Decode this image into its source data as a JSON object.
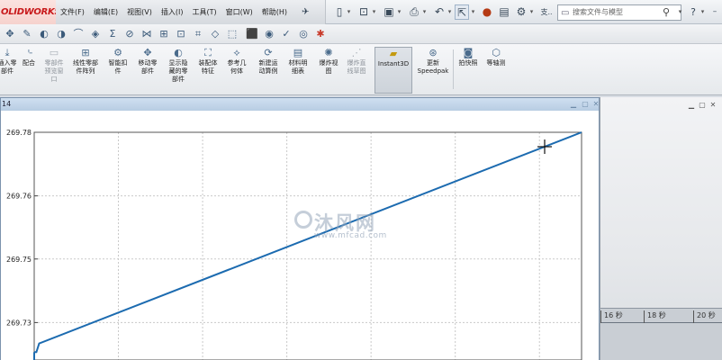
{
  "app": {
    "logo": "OLIDWORKS"
  },
  "menu": [
    "文件(F)",
    "编辑(E)",
    "视图(V)",
    "插入(I)",
    "工具(T)",
    "窗口(W)",
    "帮助(H)"
  ],
  "quickbar": {
    "more_label": "支..",
    "search_placeholder": "搜索文件与模型",
    "help_label": "?"
  },
  "commands": [
    {
      "label": "插入零\n部件",
      "icon": "insert-component-icon",
      "enabled": true
    },
    {
      "label": "配合",
      "icon": "mate-icon",
      "enabled": true
    },
    {
      "label": "零部件\n预览窗\n口",
      "icon": "component-preview-icon",
      "enabled": false
    },
    {
      "label": "线性零部\n件阵列",
      "icon": "linear-pattern-icon",
      "enabled": true
    },
    {
      "label": "智能扣\n件",
      "icon": "smart-fastener-icon",
      "enabled": true
    },
    {
      "label": "移动零\n部件",
      "icon": "move-component-icon",
      "enabled": true
    },
    {
      "label": "显示隐\n藏的零\n部件",
      "icon": "show-hidden-icon",
      "enabled": true
    },
    {
      "label": "装配体\n特征",
      "icon": "assembly-feature-icon",
      "enabled": true
    },
    {
      "label": "参考几\n何体",
      "icon": "reference-geometry-icon",
      "enabled": true
    },
    {
      "label": "新建运\n动算例",
      "icon": "motion-study-icon",
      "enabled": true
    },
    {
      "label": "材料明\n细表",
      "icon": "bom-icon",
      "enabled": true
    },
    {
      "label": "爆炸视\n图",
      "icon": "exploded-view-icon",
      "enabled": true
    },
    {
      "label": "爆炸直\n线草图",
      "icon": "explode-line-icon",
      "enabled": false
    },
    {
      "label": "Instant3D",
      "icon": "instant3d-icon",
      "enabled": true,
      "active": true
    },
    {
      "label": "更新\nSpeedpak",
      "icon": "speedpak-icon",
      "enabled": true
    },
    {
      "label": "拍快照",
      "icon": "snapshot-icon",
      "enabled": true
    },
    {
      "label": "等轴测",
      "icon": "isometric-icon",
      "enabled": true
    }
  ],
  "plot": {
    "caption": "14"
  },
  "chart_data": {
    "type": "line",
    "x": [
      0,
      0.004,
      0.009,
      1.0
    ],
    "y": [
      269.7295,
      269.7295,
      269.7315,
      269.78
    ],
    "ylim": [
      269.7277,
      269.78
    ],
    "ytick_labels": [
      "269.78",
      "269.76",
      "269.75",
      "269.73"
    ],
    "ytick_values": [
      269.78,
      269.7654,
      269.7509,
      269.7363
    ],
    "grid": true,
    "line_color": "#1c6bb0"
  },
  "watermark": {
    "text": "沐风网",
    "url": "www.mfcad.com"
  },
  "timeline": {
    "ticks": [
      "16 秒",
      "18 秒",
      "20 秒"
    ]
  }
}
